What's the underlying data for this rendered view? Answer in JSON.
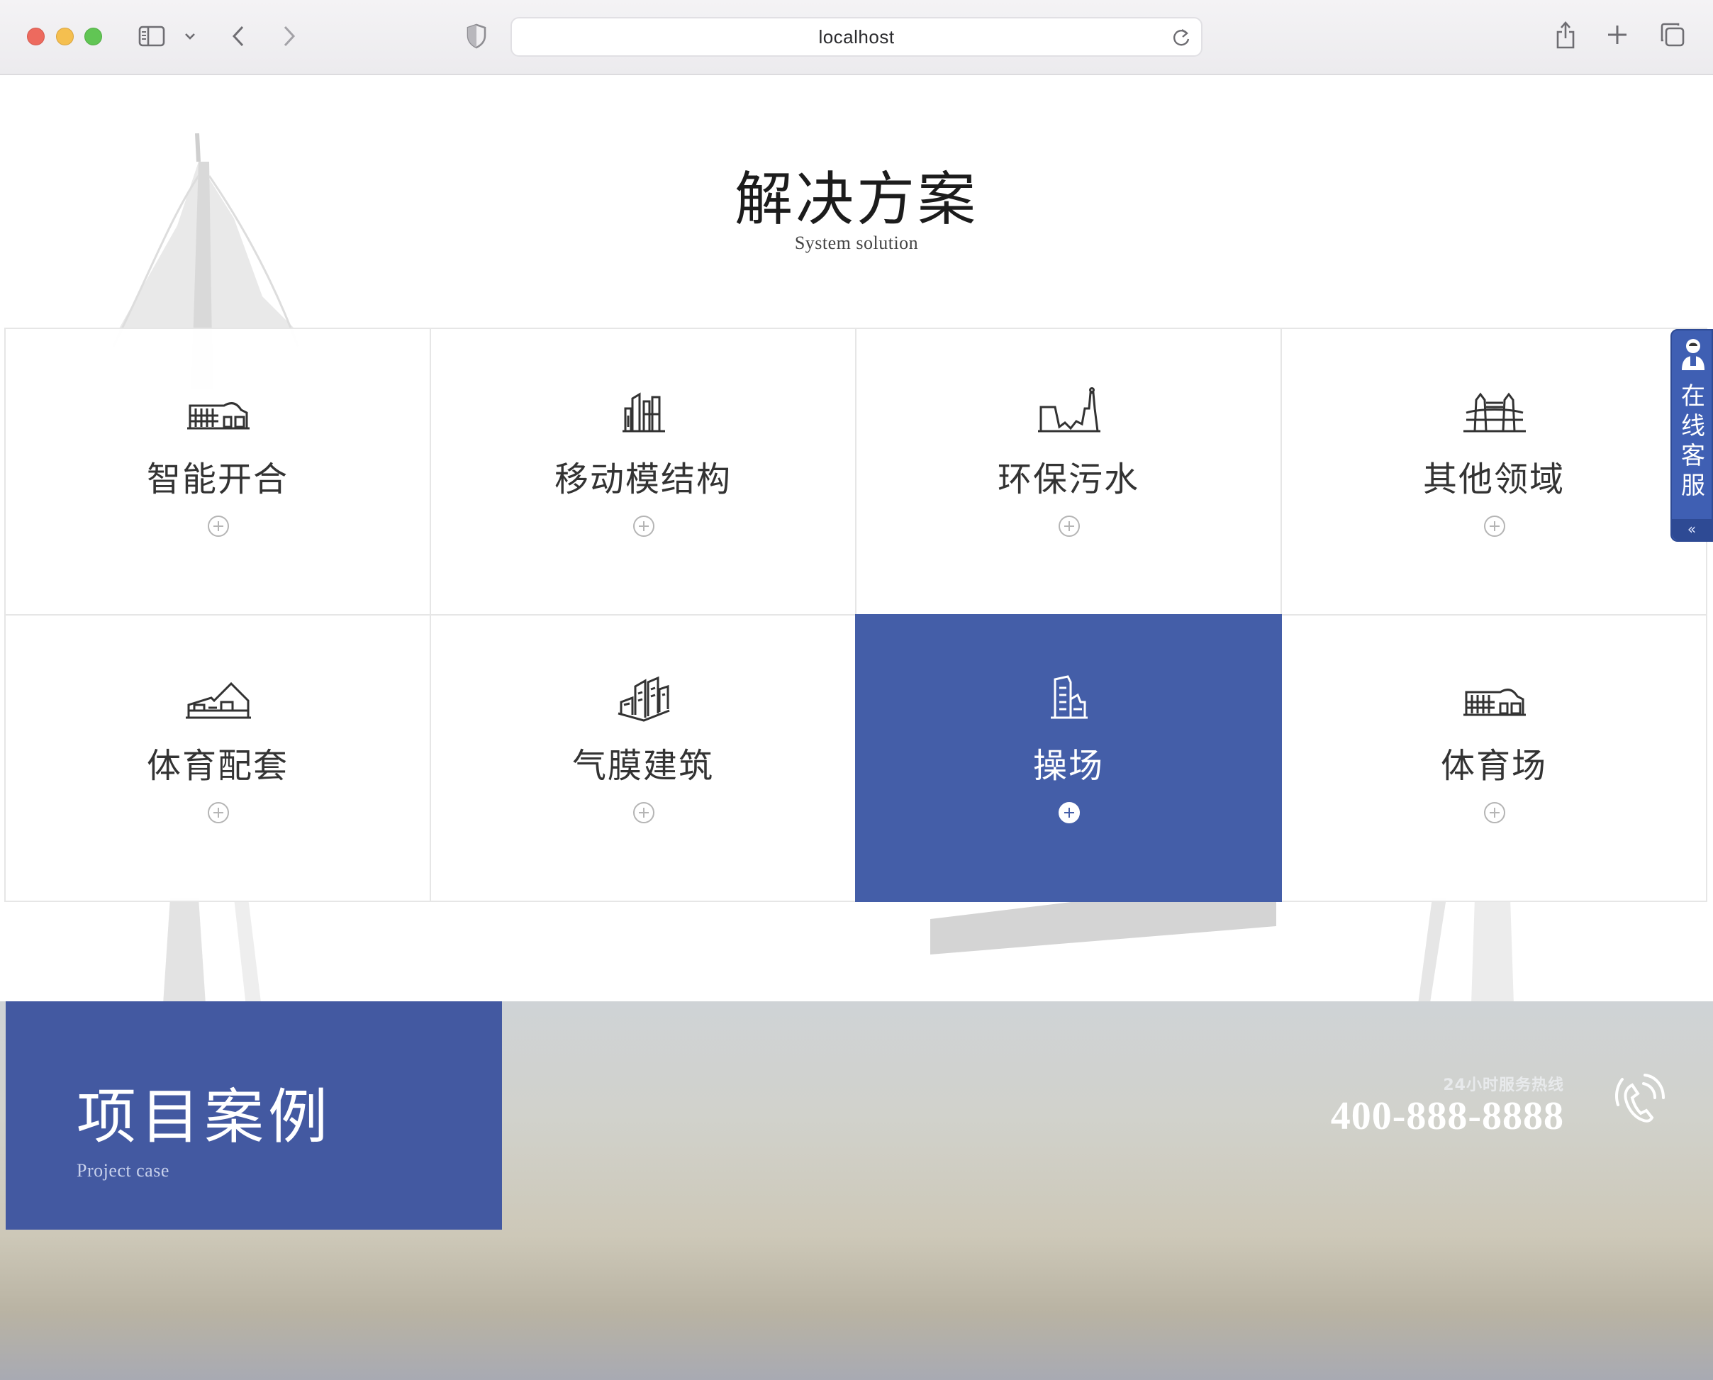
{
  "browser": {
    "url": "localhost",
    "icons": [
      "sidebar-icon",
      "chevron-down-icon",
      "back-icon",
      "forward-icon",
      "shield-icon",
      "reload-icon",
      "share-icon",
      "new-tab-icon",
      "tabs-icon"
    ]
  },
  "solutions": {
    "title": "解决方案",
    "subtitle": "System solution",
    "items": [
      {
        "label": "智能开合",
        "icon": "stadium-icon",
        "active": false
      },
      {
        "label": "移动模结构",
        "icon": "towers-icon",
        "active": false
      },
      {
        "label": "环保污水",
        "icon": "factory-icon",
        "active": false
      },
      {
        "label": "其他领域",
        "icon": "bridge-icon",
        "active": false
      },
      {
        "label": "体育配套",
        "icon": "arena-icon",
        "active": false
      },
      {
        "label": "气膜建筑",
        "icon": "buildings-icon",
        "active": false
      },
      {
        "label": "操场",
        "icon": "building-icon",
        "active": true
      },
      {
        "label": "体育场",
        "icon": "stadium-icon",
        "active": false
      }
    ]
  },
  "service_float": {
    "text": "在线客服",
    "collapse": "«"
  },
  "project_case": {
    "title": "项目案例",
    "subtitle": "Project case"
  },
  "hotline": {
    "label": "24小时服务热线",
    "number": "400-888-8888"
  },
  "colors": {
    "accent": "#445ea8",
    "case_box": "#4359a1",
    "service": "#3f5fb3"
  }
}
